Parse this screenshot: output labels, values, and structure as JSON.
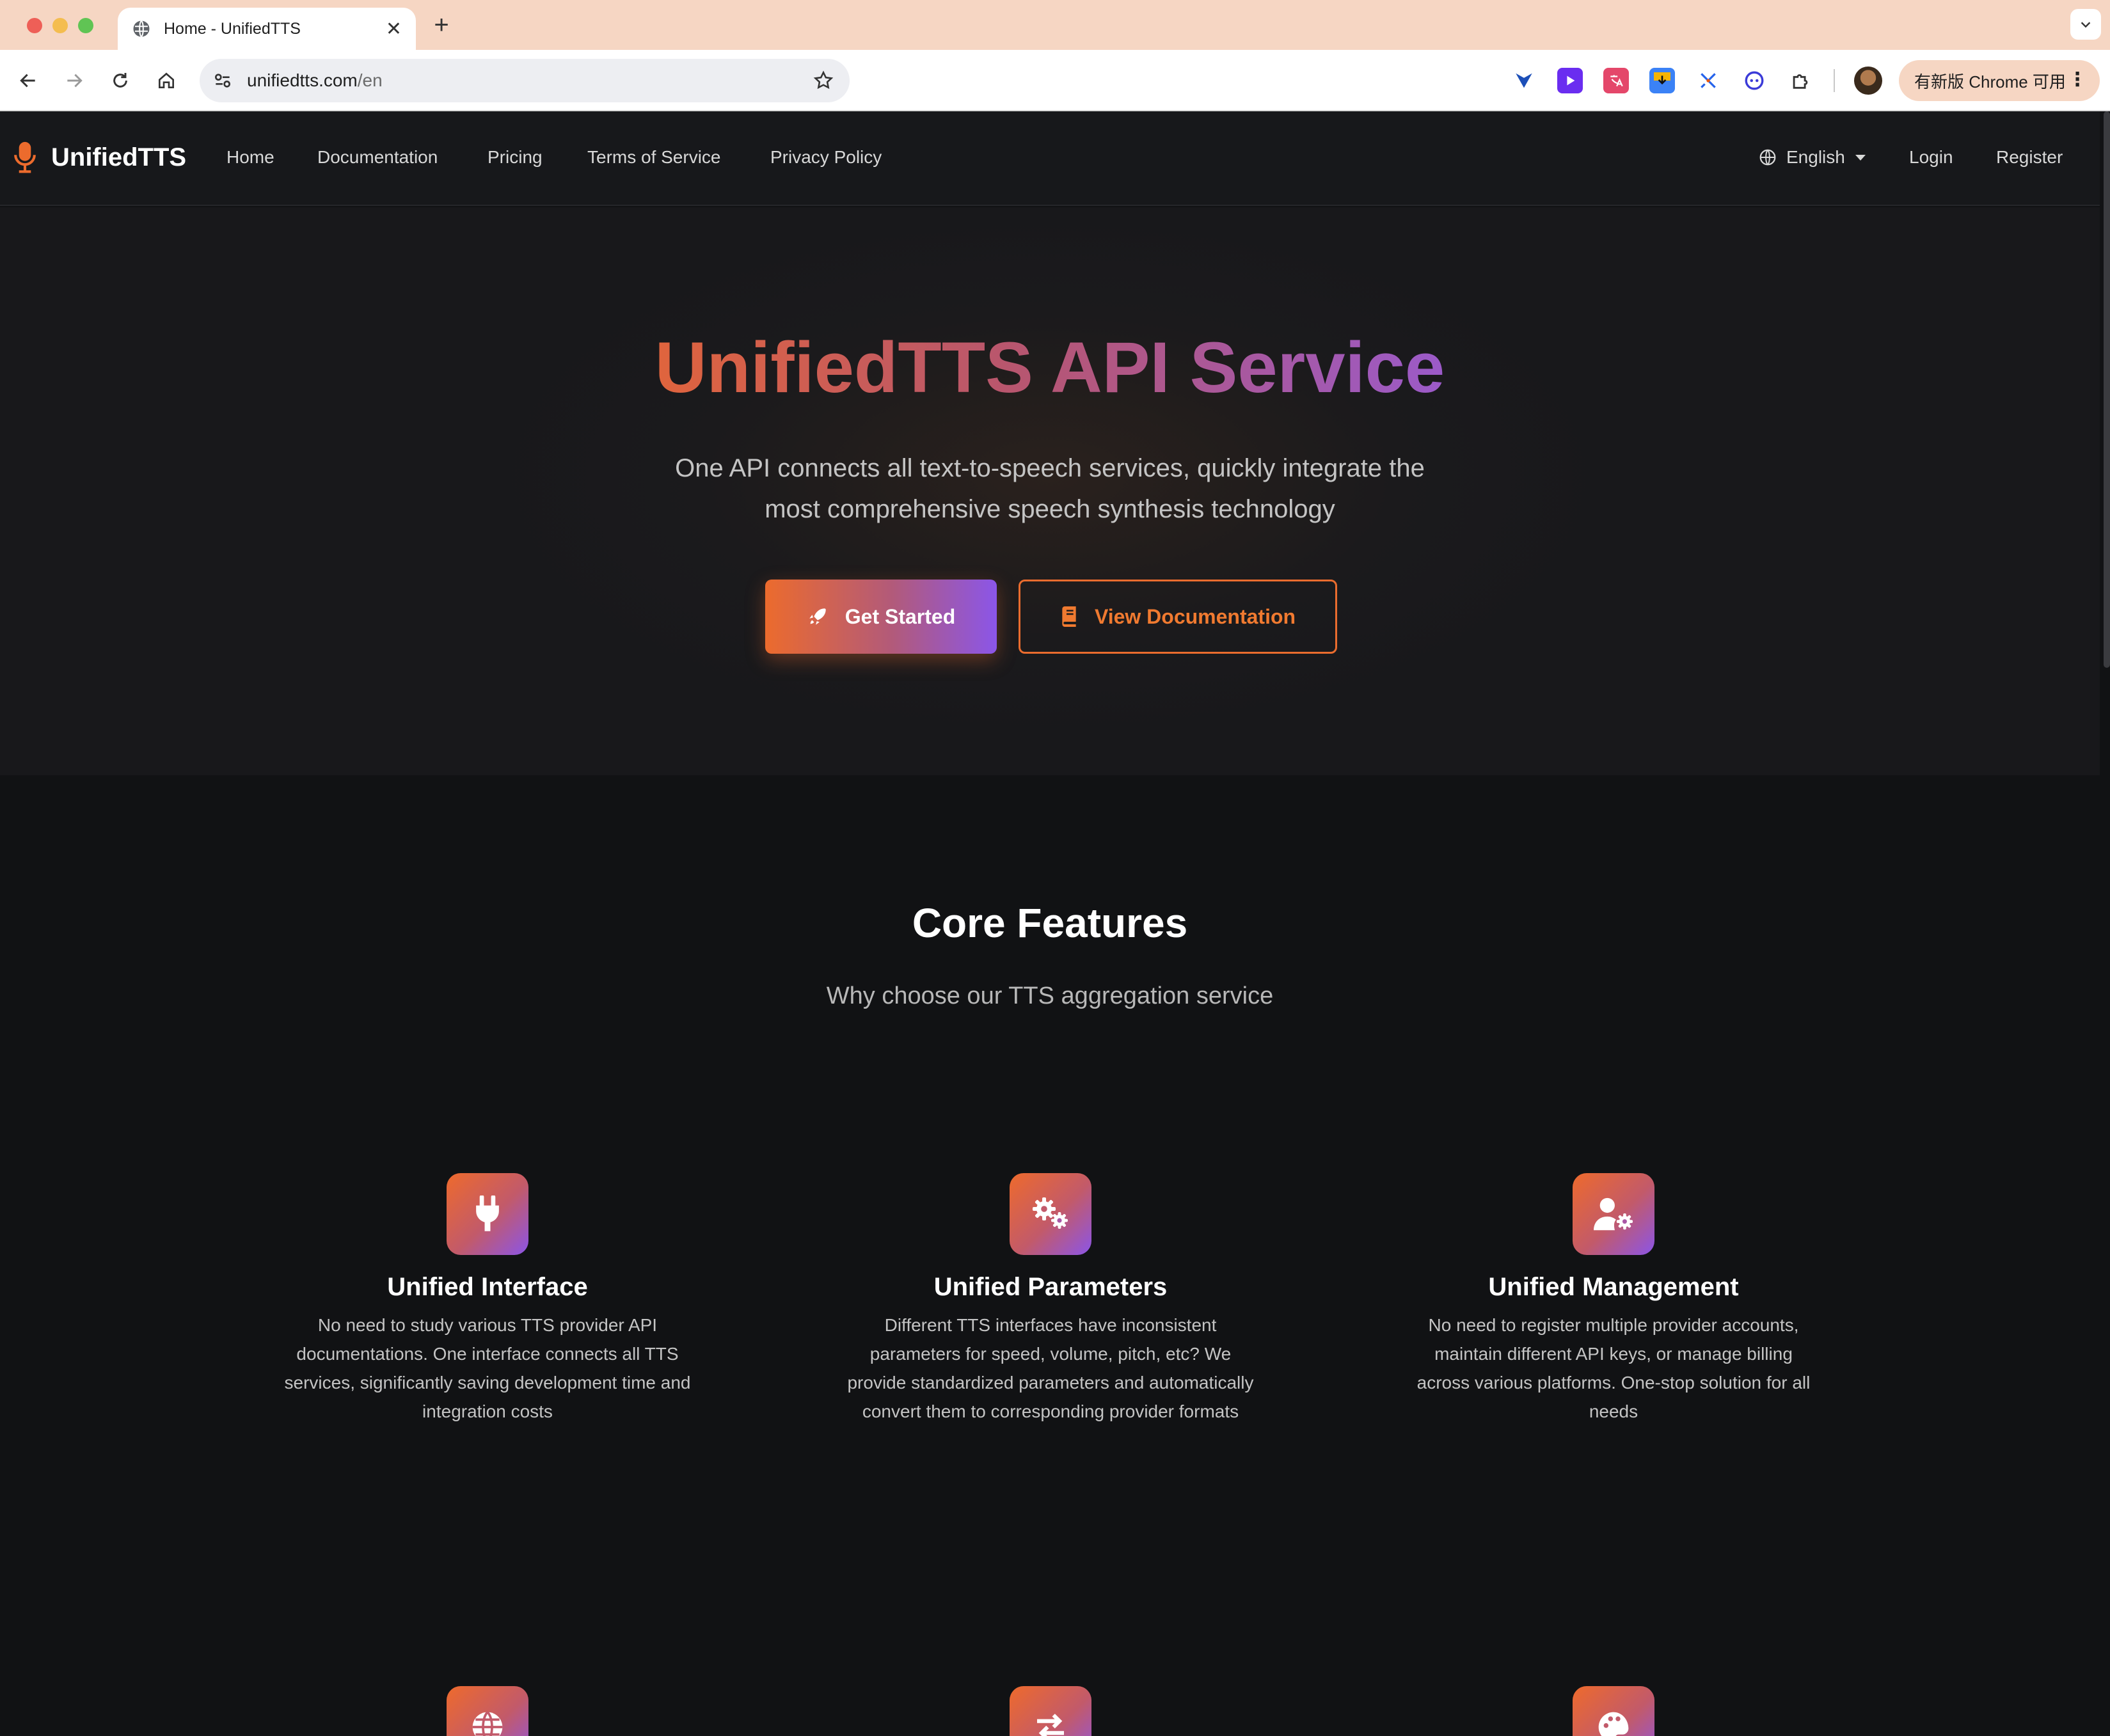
{
  "browser": {
    "tab_title": "Home - UnifiedTTS",
    "url_host": "unifiedtts.com",
    "url_path": "/en",
    "update_label": "有新版 Chrome 可用"
  },
  "site": {
    "brand": "UnifiedTTS",
    "nav": [
      "Home",
      "Documentation",
      "Pricing",
      "Terms of Service",
      "Privacy Policy"
    ],
    "language": "English",
    "login": "Login",
    "register": "Register"
  },
  "hero": {
    "title": "UnifiedTTS API Service",
    "subtitle": "One API connects all text-to-speech services, quickly integrate the most comprehensive speech synthesis technology",
    "primary_button": "Get Started",
    "secondary_button": "View Documentation"
  },
  "features": {
    "title": "Core Features",
    "subtitle": "Why choose our TTS aggregation service",
    "items": [
      {
        "icon": "plug-icon",
        "title": "Unified Interface",
        "desc": "No need to study various TTS provider API documentations. One interface connects all TTS services, significantly saving development time and integration costs"
      },
      {
        "icon": "gears-icon",
        "title": "Unified Parameters",
        "desc": "Different TTS interfaces have inconsistent parameters for speed, volume, pitch, etc? We provide standardized parameters and automatically convert them to corresponding provider formats"
      },
      {
        "icon": "user-gear-icon",
        "title": "Unified Management",
        "desc": "No need to register multiple provider accounts, maintain different API keys, or manage billing across various platforms. One-stop solution for all needs"
      }
    ],
    "more_icons": [
      "globe-icon",
      "exchange-icon",
      "palette-icon"
    ]
  },
  "colors": {
    "accent_orange": "#ec6b2d",
    "accent_purple": "#8b56e8",
    "background": "#111214"
  }
}
